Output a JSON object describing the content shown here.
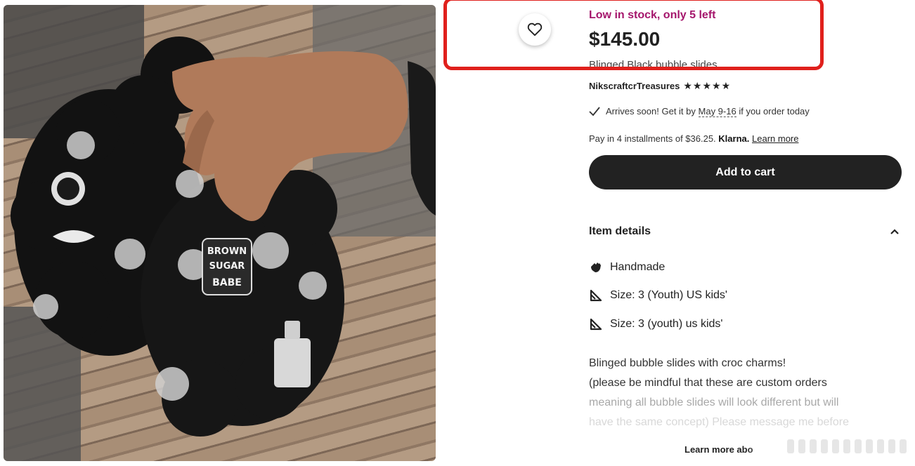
{
  "photo": {
    "alt": "Blinged black bubble slides",
    "charm_text": "BROWN SUGAR BABE"
  },
  "favorite": {
    "icon": "heart-icon"
  },
  "listing": {
    "stock_notice": "Low in stock, only 5 left",
    "price": "$145.00",
    "title": "Blinged Black bubble slides"
  },
  "shop": {
    "name": "NikscraftcrTreasures",
    "stars": "★★★★★"
  },
  "delivery": {
    "prefix": "Arrives soon! Get it by",
    "dates": "May 9-16",
    "suffix": "if you order today"
  },
  "payment": {
    "text": "Pay in 4 installments of $36.25.",
    "provider": "Klarna.",
    "learn_more": "Learn more"
  },
  "cart": {
    "button_label": "Add to cart"
  },
  "item_details": {
    "heading": "Item details",
    "rows": [
      {
        "icon": "hand-icon",
        "text": "Handmade"
      },
      {
        "icon": "ruler-triangle-icon",
        "text": "Size: 3 (Youth) US kids'"
      },
      {
        "icon": "ruler-triangle-icon",
        "text": "Size: 3 (youth) us kids'"
      }
    ]
  },
  "description": {
    "line1": "Blinged bubble slides with croc charms!",
    "line2": "(please be mindful that these are custom orders",
    "line3": "meaning all bubble slides will look different but will",
    "line4": "have the same concept) Please message me before"
  },
  "learn_more_link": "Learn more abo",
  "colors": {
    "stock": "#a5166c",
    "button": "#222222",
    "highlight": "#e0201c"
  }
}
